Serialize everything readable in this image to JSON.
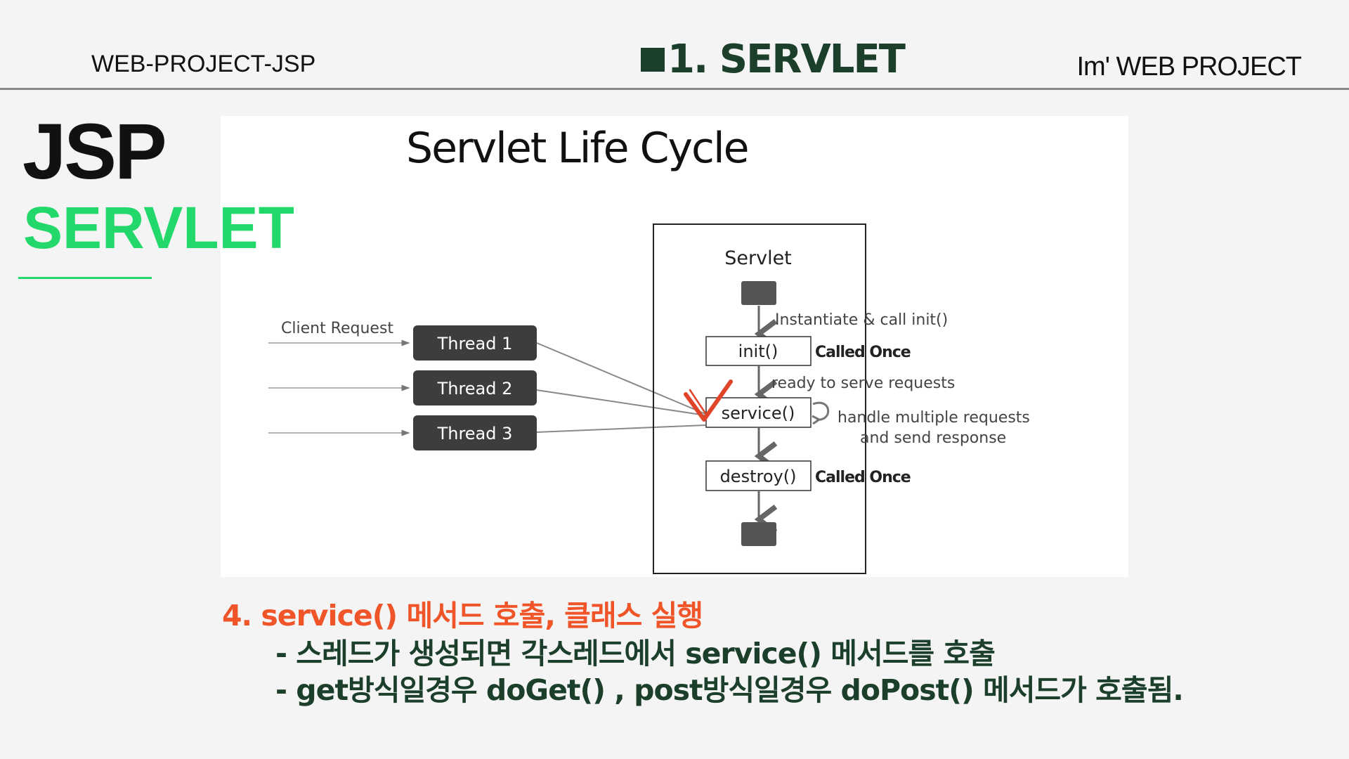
{
  "header": {
    "left": "WEB-PROJECT-JSP",
    "center": "1. SERVLET",
    "right": "Im' WEB PROJECT"
  },
  "sidebar": {
    "title": "JSP",
    "subtitle": "SERVLET"
  },
  "diagram": {
    "title": "Servlet Life Cycle",
    "client_request": "Client Request",
    "threads": [
      "Thread 1",
      "Thread 2",
      "Thread 3"
    ],
    "servlet_label": "Servlet",
    "steps": {
      "instantiate": "Instantiate & call init()",
      "init": "init()",
      "ready": "ready to serve requests",
      "service": "service()",
      "handle_line1": "handle multiple requests",
      "handle_line2": "and send response",
      "destroy": "destroy()",
      "called_once": "Called Once"
    },
    "colors": {
      "thread_box": "#3d3d3d",
      "check_mark": "#e0452a"
    }
  },
  "caption": {
    "heading": "4. service() 메서드 호출, 클래스 실행",
    "bullets": [
      "- 스레드가 생성되면 각스레드에서 service() 메서드를 호출",
      "- get방식일경우 doGet() , post방식일경우 doPost() 메서드가 호출됨."
    ]
  },
  "colors": {
    "accent_green": "#22d86a",
    "dark_green": "#1c3f2b",
    "accent_orange": "#f0552a"
  }
}
